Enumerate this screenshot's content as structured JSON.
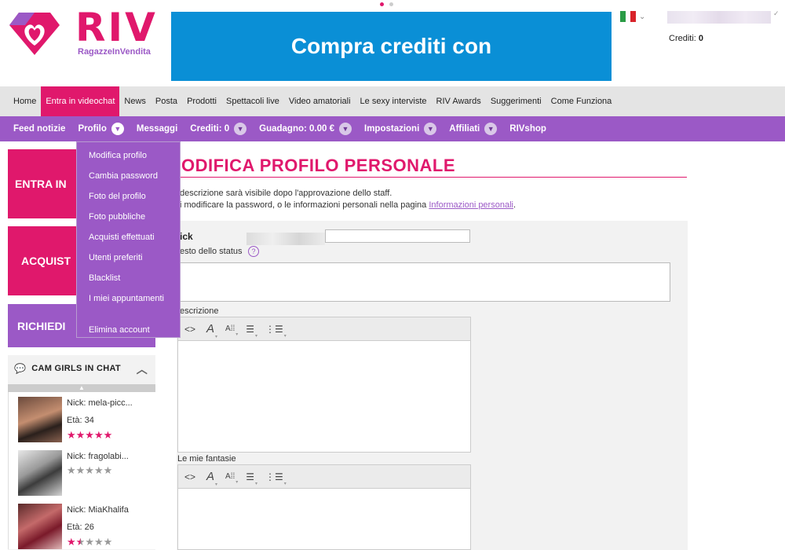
{
  "header": {
    "logo_text": "RIV",
    "logo_sub": "RagazzeInVendita",
    "banner_text": "Compra crediti con",
    "credits_label": "Crediti:",
    "credits_value": "0"
  },
  "main_nav": {
    "items": [
      {
        "label": "Home",
        "active": false
      },
      {
        "label": "Entra in videochat",
        "active": true
      },
      {
        "label": "News",
        "active": false
      },
      {
        "label": "Posta",
        "active": false
      },
      {
        "label": "Prodotti",
        "active": false
      },
      {
        "label": "Spettacoli live",
        "active": false
      },
      {
        "label": "Video amatoriali",
        "active": false
      },
      {
        "label": "Le sexy interviste",
        "active": false
      },
      {
        "label": "RIV Awards",
        "active": false
      },
      {
        "label": "Suggerimenti",
        "active": false
      },
      {
        "label": "Come Funziona",
        "active": false
      }
    ]
  },
  "sub_nav": {
    "feed": "Feed notizie",
    "profilo": "Profilo",
    "messaggi": "Messaggi",
    "crediti": "Crediti: 0",
    "guadagno": "Guadagno: 0.00 €",
    "impostazioni": "Impostazioni",
    "affiliati": "Affiliati",
    "rivshop": "RIVshop"
  },
  "profile_menu": {
    "items": [
      "Modifica profilo",
      "Cambia password",
      "Foto del profilo",
      "Foto pubbliche",
      "Acquisti effettuati",
      "Utenti preferiti",
      "Blacklist",
      "I miei appuntamenti"
    ],
    "delete": "Elimina account"
  },
  "sidebar": {
    "btn_entra": "ENTRA IN",
    "btn_acquista": "ACQUIST",
    "btn_richiedi": "RICHIEDI",
    "cam_title": "CAM GIRLS IN CHAT",
    "cams": [
      {
        "nick": "Nick: mela-picc...",
        "age": "Età: 34",
        "rating": 5
      },
      {
        "nick": "Nick: fragolabi...",
        "age": "",
        "rating": 0
      },
      {
        "nick": "Nick: MiaKhalifa",
        "age": "Età: 26",
        "rating": 1.5
      }
    ]
  },
  "content": {
    "title": "ODIFICA PROFILO PERSONALE",
    "info1": "descrizione sarà visibile dopo l'approvazione dello staff.",
    "info2_prefix": "i modificare la password, o le informazioni personali nella pagina ",
    "info2_link": "Informazioni personali",
    "info2_suffix": ".",
    "nick_label": "ick",
    "status_label": "esto dello status",
    "desc_label": "escrizione",
    "fantasie_label": "Le mie fantasie"
  },
  "colors": {
    "pink": "#e0186c",
    "purple": "#9b59c6",
    "banner_blue": "#0a8fd6"
  }
}
